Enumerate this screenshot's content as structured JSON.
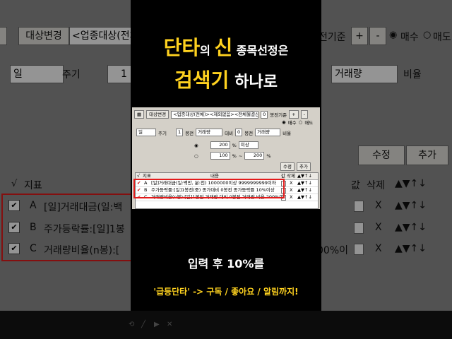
{
  "headline": {
    "line1": {
      "a": "단타",
      "b": "의 ",
      "c": "신",
      "d": " 종목선정은"
    },
    "line2": {
      "a": "검색기",
      "b": "하나로"
    }
  },
  "search_window": {
    "toolbar": {
      "target_btn": "대상변경",
      "target_value": "<업종대상(전체)><제외없음><전체월결산>",
      "basis_num": "0",
      "basis_label": "봉전기준",
      "plus": "+",
      "minus": "-",
      "buy": "매수",
      "sell": "매도"
    },
    "cond_row1": {
      "period": "일",
      "period_label": "주기",
      "n": "1",
      "bong_label": "봉전",
      "metric": "거래량",
      "compare_label": "대비",
      "n2": "0",
      "bong2_label": "봉전",
      "metric2": "거래량",
      "ratio_label": "비율"
    },
    "cond_row2": {
      "value": "200",
      "unit": "%",
      "op": "미상"
    },
    "cond_row3": {
      "from": "100",
      "tilde": "~",
      "to": "200",
      "unit": "%"
    },
    "edit_btn": "수정",
    "add_btn": "추가",
    "table": {
      "headers": {
        "check": "√",
        "index": "지표",
        "content": "내용",
        "value": "값",
        "delete": "삭제",
        "controls": "▲▼↑↓"
      },
      "rows": [
        {
          "check": "✔",
          "letter": "A",
          "text": "[일]거래대금(일:백만, 분:천) 1000000이상 9999999999이하",
          "del": "X",
          "ctrl": "▲▼↑↓"
        },
        {
          "check": "✔",
          "letter": "B",
          "text": "주가등락률:[일]1봉전(중) 종가대비 0봉전 종가등락률 10%이상",
          "del": "X",
          "ctrl": "▲▼↑↓"
        },
        {
          "check": "✔",
          "letter": "C",
          "text": "거래량비율(n봉):[일]1봉전 거래량 대비 0봉전 거래량 비율 200%이",
          "del": "X",
          "ctrl": "▲▼↑↓"
        }
      ]
    }
  },
  "background_left": {
    "target_btn": "대상변경",
    "target_value": "<업종대상(전체",
    "period": "일",
    "period_label": "주기",
    "n": "1",
    "header_check": "√",
    "header_index": "지표",
    "rows": [
      {
        "letter": "A",
        "text": "[일]거래대금(일:백"
      },
      {
        "letter": "B",
        "text": "주가등락률:[일]1봉"
      },
      {
        "letter": "C",
        "text": "거래량비율(n봉):["
      }
    ]
  },
  "background_right": {
    "basis_label": "전기준",
    "plus": "+",
    "minus": "-",
    "buy": "매수",
    "sell": "매도",
    "metric": "거래량",
    "ratio_label": "비율",
    "edit_btn": "수정",
    "add_btn": "추가",
    "header_value": "값",
    "header_delete": "삭제",
    "header_ctrl": "▲▼↑↓",
    "row_del": "X",
    "row_ctrl": "▲▼↑↓",
    "row_c_tail": "00%이"
  },
  "captions": {
    "line1": "입력 후 10%를",
    "line2": "'급등단타' -> 구독 / 좋아요 / 알림까지!"
  },
  "player_controls": {
    "a": "⟲",
    "b": "╱",
    "c": "▶",
    "d": "✕"
  },
  "colors": {
    "highlight_yellow": "#ffd21f",
    "frame_red": "#e31b1b",
    "window_gray": "#d4d0c8"
  }
}
